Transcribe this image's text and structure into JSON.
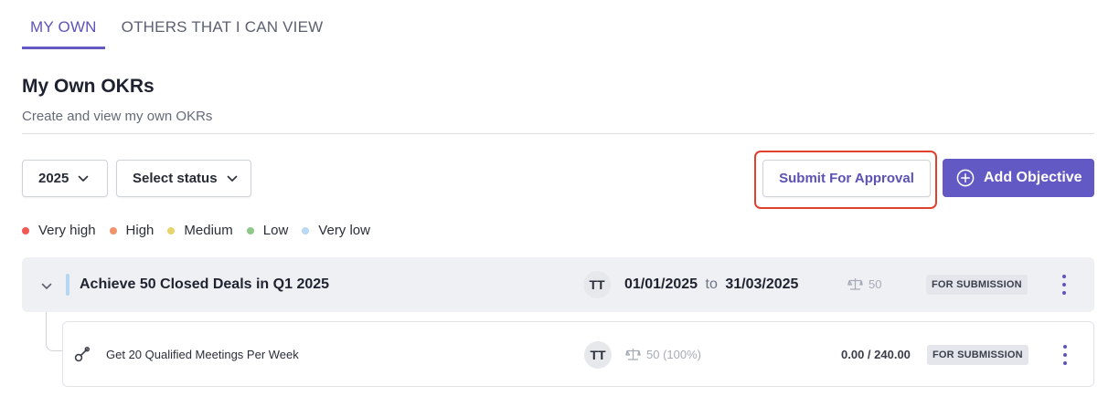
{
  "tabs": [
    {
      "label": "MY OWN",
      "active": true
    },
    {
      "label": "OTHERS THAT I CAN VIEW",
      "active": false
    }
  ],
  "page": {
    "title": "My Own OKRs",
    "subtitle": "Create and view my own OKRs"
  },
  "filters": {
    "year": "2025",
    "status": "Select status"
  },
  "actions": {
    "submit_label": "Submit For Approval",
    "add_label": "Add Objective"
  },
  "legend": [
    {
      "label": "Very high",
      "color": "#ee5a52"
    },
    {
      "label": "High",
      "color": "#f0936a"
    },
    {
      "label": "Medium",
      "color": "#e9d46a"
    },
    {
      "label": "Low",
      "color": "#8ec98a"
    },
    {
      "label": "Very low",
      "color": "#b9d8f3"
    }
  ],
  "objective": {
    "title": "Achieve 50 Closed Deals in Q1 2025",
    "owner_initials": "TT",
    "start_date": "01/01/2025",
    "to_label": "to",
    "end_date": "31/03/2025",
    "weight": "50",
    "status": "FOR SUBMISSION",
    "bar_color": "#b7d6f2"
  },
  "key_result": {
    "title": "Get 20 Qualified Meetings Per Week",
    "owner_initials": "TT",
    "weight": "50 (100%)",
    "progress": "0.00 / 240.00",
    "status": "FOR SUBMISSION"
  },
  "colors": {
    "accent": "#6259c4",
    "highlight": "#e0402d"
  }
}
